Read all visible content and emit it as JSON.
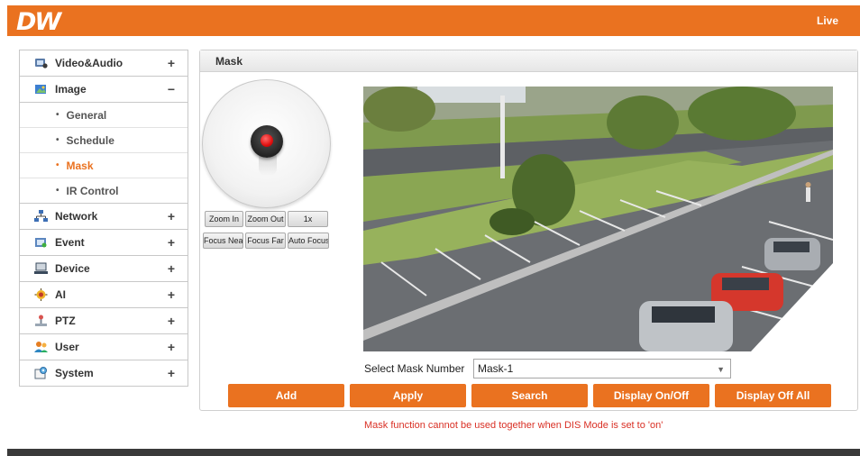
{
  "brand": {
    "logo": "DW",
    "accent": "#ea7220"
  },
  "header": {
    "live_label": "Live"
  },
  "sidebar": {
    "items": [
      {
        "label": "Video&Audio",
        "toggle": "+",
        "icon": "video-audio-icon"
      },
      {
        "label": "Image",
        "toggle": "−",
        "icon": "image-icon",
        "children": [
          {
            "label": "General"
          },
          {
            "label": "Schedule"
          },
          {
            "label": "Mask",
            "active": true
          },
          {
            "label": "IR Control"
          }
        ]
      },
      {
        "label": "Network",
        "toggle": "+",
        "icon": "network-icon"
      },
      {
        "label": "Event",
        "toggle": "+",
        "icon": "event-icon"
      },
      {
        "label": "Device",
        "toggle": "+",
        "icon": "device-icon"
      },
      {
        "label": "AI",
        "toggle": "+",
        "icon": "ai-icon"
      },
      {
        "label": "PTZ",
        "toggle": "+",
        "icon": "ptz-icon"
      },
      {
        "label": "User",
        "toggle": "+",
        "icon": "user-icon"
      },
      {
        "label": "System",
        "toggle": "+",
        "icon": "system-icon"
      }
    ]
  },
  "panel": {
    "title": "Mask"
  },
  "ptz_controls": {
    "zoom_in": "Zoom In",
    "zoom_out": "Zoom Out",
    "zoom_1x": "1x",
    "focus_near": "Focus Near",
    "focus_far": "Focus Far",
    "auto_focus": "Auto Focus"
  },
  "mask": {
    "select_label": "Select Mask Number",
    "selected": "Mask-1"
  },
  "actions": {
    "add": "Add",
    "apply": "Apply",
    "search": "Search",
    "display_on_off": "Display On/Off",
    "display_off_all": "Display Off All"
  },
  "warning": "Mask function cannot be used together when DIS Mode is set to 'on'"
}
